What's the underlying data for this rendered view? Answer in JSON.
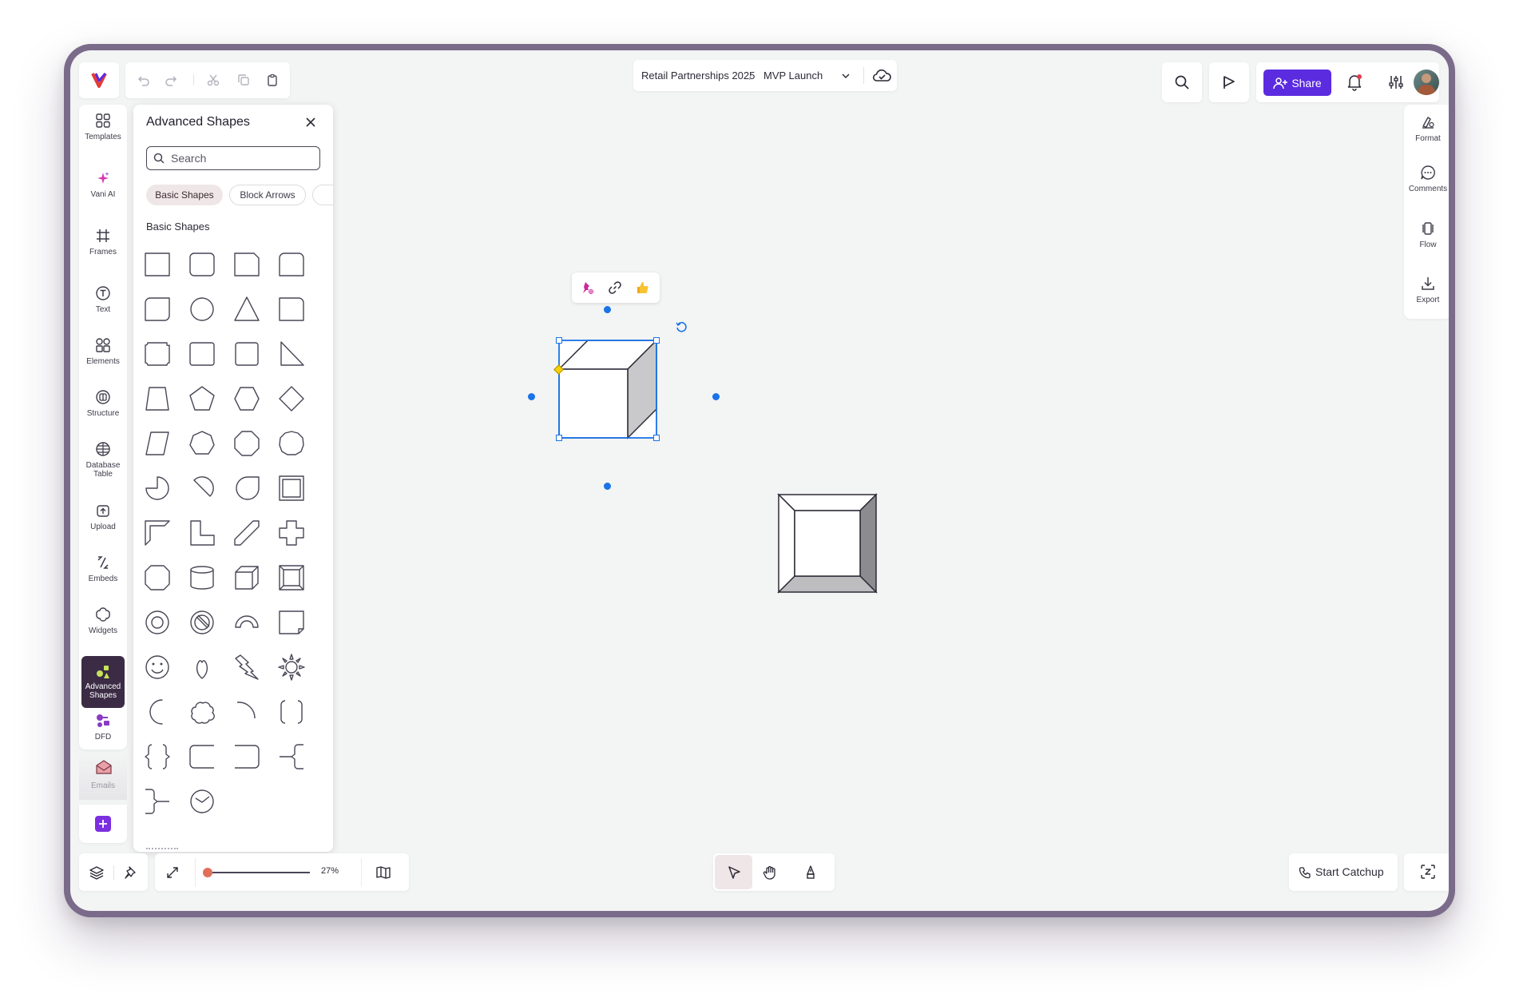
{
  "breadcrumb": {
    "project": "Retail Partnerships 2025",
    "separator": "/",
    "board": "MVP Launch"
  },
  "header": {
    "share_label": "Share"
  },
  "left_toolbar": [
    {
      "label": "Templates",
      "icon": "grid-icon"
    },
    {
      "label": "Vani AI",
      "icon": "sparkle-icon"
    },
    {
      "label": "Frames",
      "icon": "hash-frame-icon"
    },
    {
      "label": "Text",
      "icon": "text-icon"
    },
    {
      "label": "Elements",
      "icon": "elements-icon"
    },
    {
      "label": "Structure",
      "icon": "structure-icon"
    },
    {
      "label": "Database Table",
      "icon": "database-icon"
    },
    {
      "label": "Upload",
      "icon": "upload-icon"
    },
    {
      "label": "Embeds",
      "icon": "embed-icon"
    },
    {
      "label": "Widgets",
      "icon": "widget-icon"
    },
    {
      "label": "Advanced Shapes",
      "icon": "advanced-shapes-icon"
    },
    {
      "label": "DFD",
      "icon": "dfd-icon"
    },
    {
      "label": "Emails",
      "icon": "email-icon"
    }
  ],
  "panel": {
    "title": "Advanced Shapes",
    "search_placeholder": "Search",
    "chips": [
      "Basic Shapes",
      "Block Arrows"
    ],
    "section_title": "Basic Shapes"
  },
  "right_toolbar": [
    {
      "label": "Format",
      "icon": "format-icon"
    },
    {
      "label": "Comments",
      "icon": "comment-icon"
    },
    {
      "label": "Flow",
      "icon": "flow-icon"
    },
    {
      "label": "Export",
      "icon": "export-icon"
    }
  ],
  "zoom": {
    "level": "27%",
    "slider_fraction": 0.0
  },
  "catchup": {
    "label": "Start Catchup"
  },
  "colors": {
    "accent": "#5b2be0",
    "active_nav": "#3b2b44",
    "selection": "#1a73e8",
    "zoom_knob": "#e0705a"
  }
}
